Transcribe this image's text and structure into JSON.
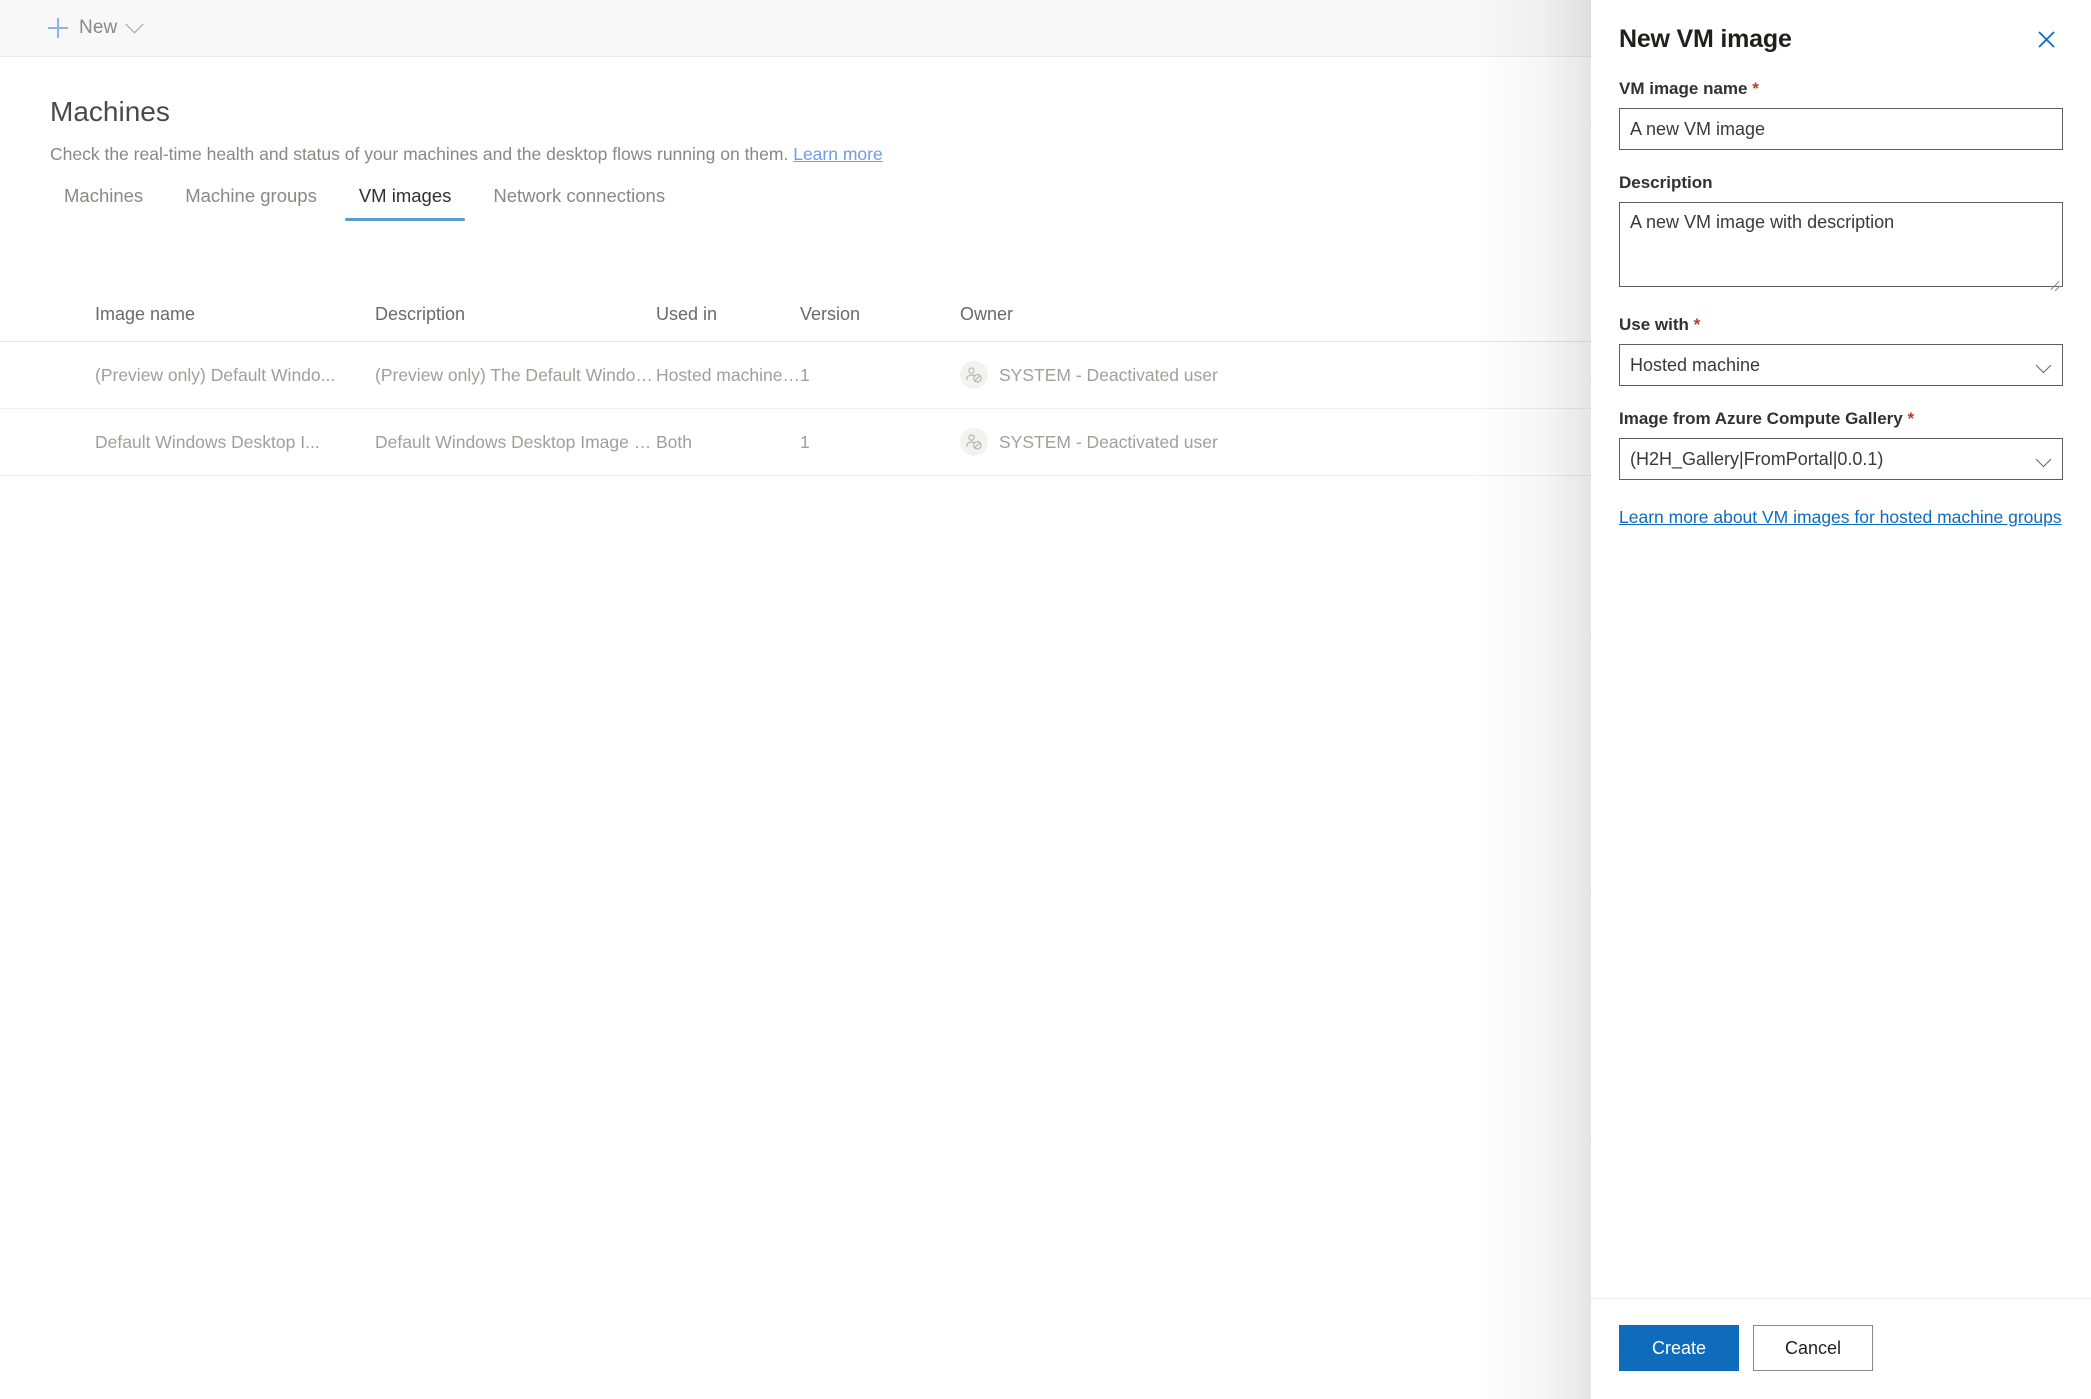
{
  "commandbar": {
    "new_label": "New",
    "plus_icon": "plus-icon",
    "chevron_icon": "chevron-down-icon"
  },
  "page": {
    "title": "Machines",
    "subtitle_text": "Check the real-time health and status of your machines and the desktop flows running on them.",
    "subtitle_link": "Learn more"
  },
  "tabs": [
    {
      "label": "Machines",
      "active": false
    },
    {
      "label": "Machine groups",
      "active": false
    },
    {
      "label": "VM images",
      "active": true
    },
    {
      "label": "Network connections",
      "active": false
    }
  ],
  "table": {
    "columns": [
      "Image name",
      "Description",
      "Used in",
      "Version",
      "Owner"
    ],
    "rows": [
      {
        "image_name": "(Preview only) Default Windo...",
        "description": "(Preview only) The Default Windows Desk...",
        "used_in": "Hosted machine group",
        "version": "1",
        "owner": "SYSTEM - Deactivated user",
        "owner_icon": "deactivated-user-icon"
      },
      {
        "image_name": "Default Windows Desktop I...",
        "description": "Default Windows Desktop Image for use i...",
        "used_in": "Both",
        "version": "1",
        "owner": "SYSTEM - Deactivated user",
        "owner_icon": "deactivated-user-icon"
      }
    ]
  },
  "panel": {
    "title": "New VM image",
    "close_icon": "close-icon",
    "fields": {
      "vm_image_name": {
        "label": "VM image name",
        "required": "*",
        "value": "A new VM image",
        "placeholder": "A new VM image"
      },
      "description": {
        "label": "Description",
        "required": "",
        "value": "A new VM image with description",
        "placeholder": "A new VM image with description"
      },
      "use_with": {
        "label": "Use with",
        "required": "*",
        "value": "Hosted machine",
        "chevron_icon": "chevron-down-icon"
      },
      "gallery_image": {
        "label": "Image from Azure Compute Gallery",
        "required": "*",
        "value": "(H2H_Gallery|FromPortal|0.0.1)",
        "chevron_icon": "chevron-down-icon"
      }
    },
    "help_link": "Learn more about VM images for hosted machine groups",
    "create_label": "Create",
    "cancel_label": "Cancel"
  },
  "colors": {
    "accent": "#0f6cbd",
    "tab_underline": "#5b9bd5",
    "required_star": "#c0392b",
    "commandbar_bg": "#f8f8f8",
    "muted_text": "#a19f9d"
  }
}
